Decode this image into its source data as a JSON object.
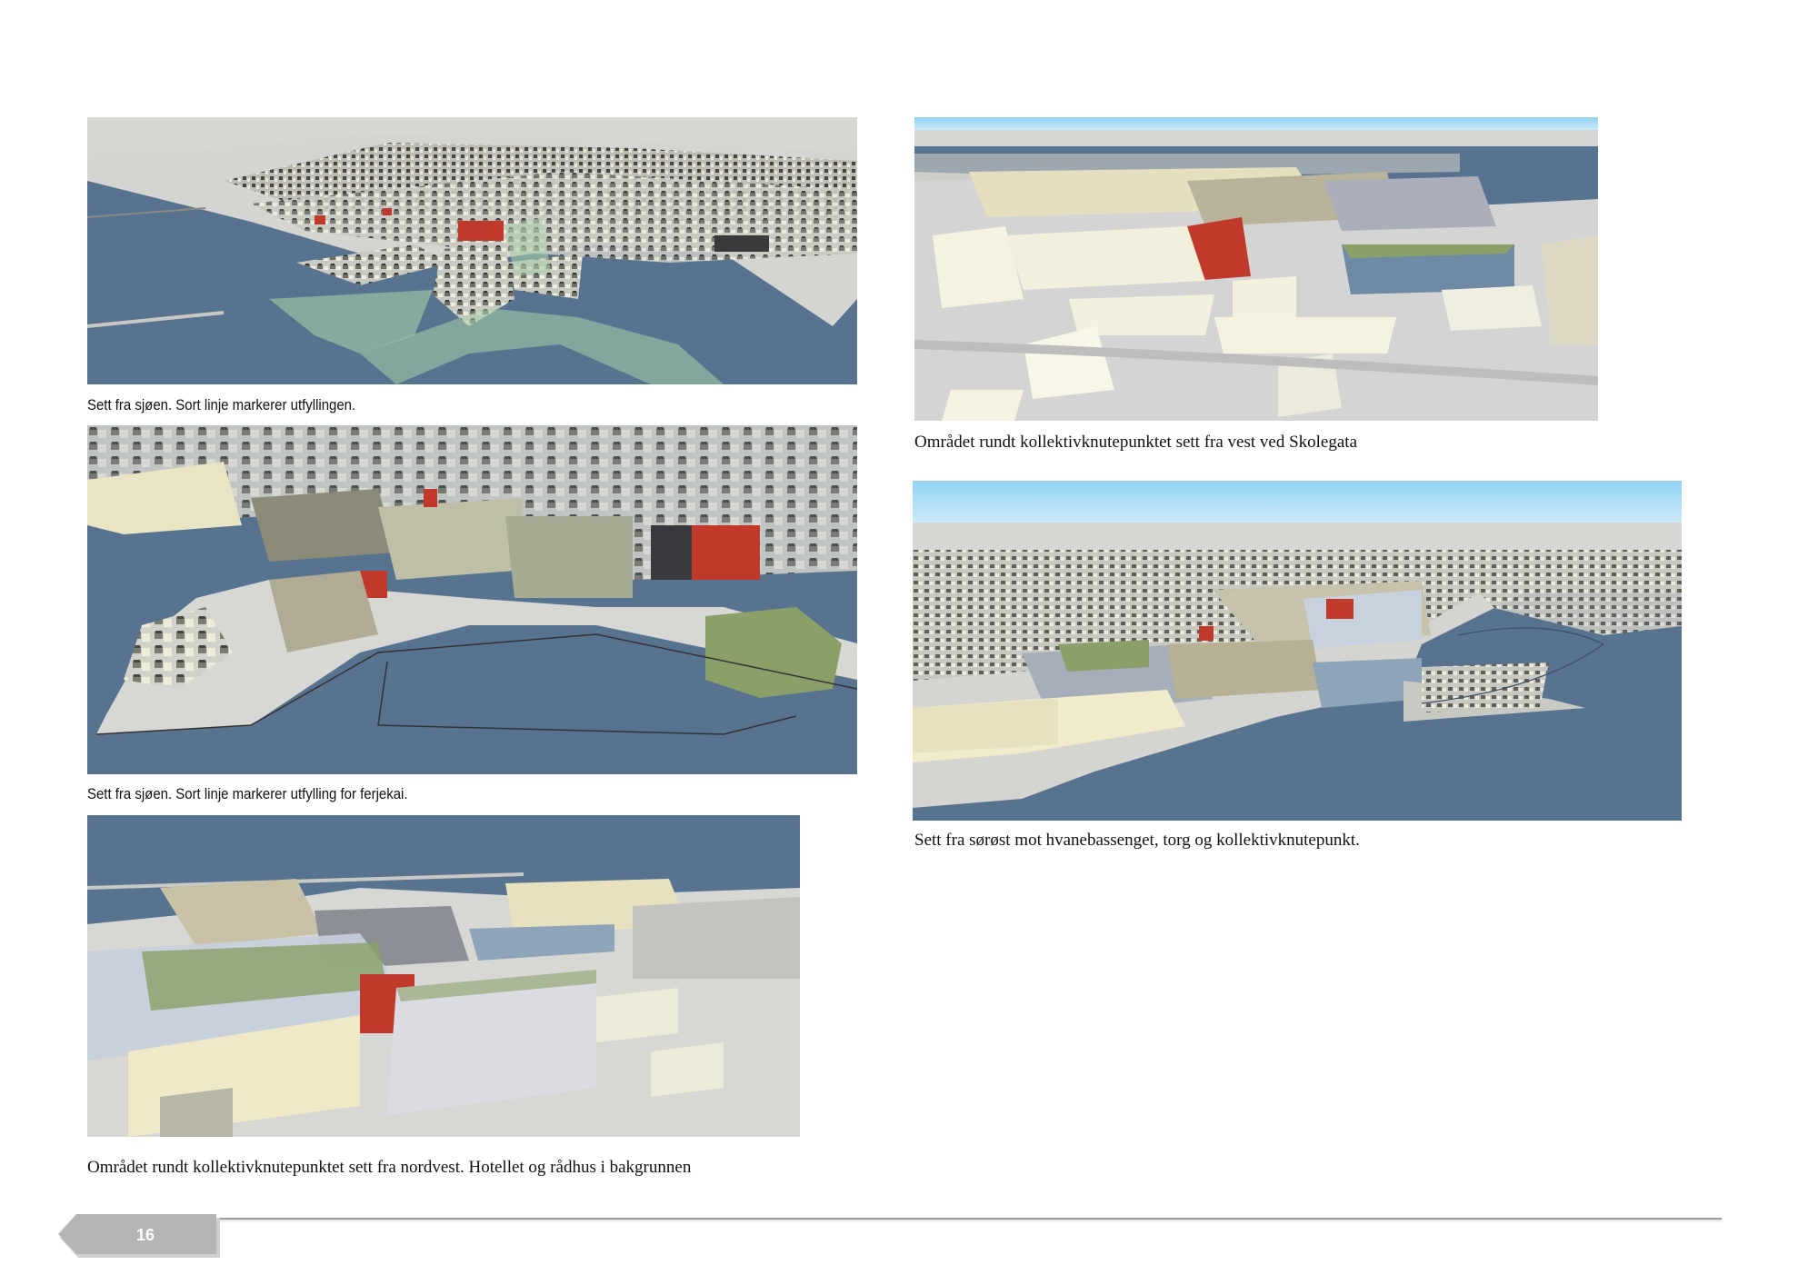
{
  "page": {
    "number": "16"
  },
  "figures": [
    {
      "id": "fig1",
      "caption": "Sett fra sjøen. Sort linje markerer utfyllingen."
    },
    {
      "id": "fig2",
      "caption": "Sett fra sjøen. Sort linje markerer utfylling for ferjekai."
    },
    {
      "id": "fig3",
      "caption": "Området rundt kollektivknutepunktet sett fra nordvest. Hotellet og rådhus i bakgrunnen"
    },
    {
      "id": "fig4",
      "caption": "Området rundt kollektivknutepunktet sett fra vest ved Skolegata"
    },
    {
      "id": "fig5",
      "caption": "Sett fra sørøst mot hvanebassenget, torg og kollektivknutepunkt."
    }
  ],
  "colors": {
    "sea": "#587390",
    "land": "#d9d9d9",
    "sky": "#8fd3f3",
    "red_buildings": "#c0392b",
    "green_fill": "#a8cfa8"
  }
}
